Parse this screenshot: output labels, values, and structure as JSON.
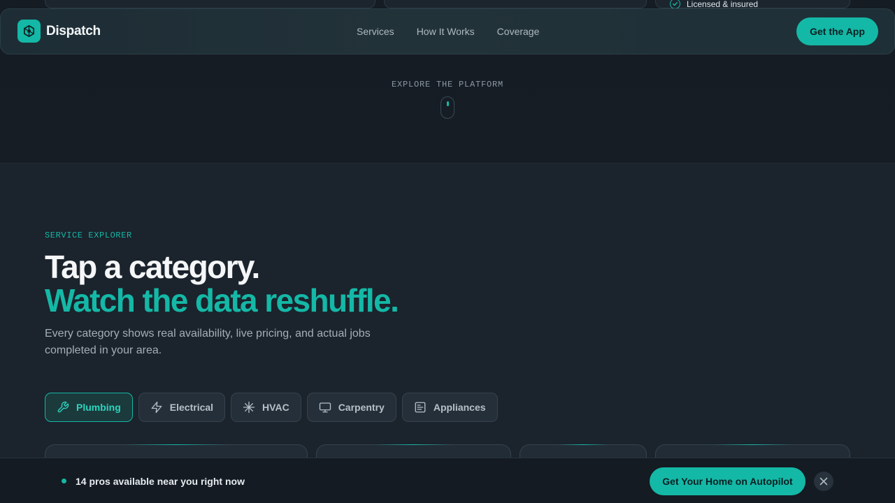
{
  "top_peek": {
    "check_label": "Licensed & insured"
  },
  "nav": {
    "brand": "Dispatch",
    "links": [
      "Services",
      "How It Works",
      "Coverage"
    ],
    "cta": "Get the App"
  },
  "scroll_cue": {
    "label": "EXPLORE THE PLATFORM"
  },
  "explorer": {
    "eyebrow": "SERVICE EXPLORER",
    "headline_1": "Tap a category.",
    "headline_2": "Watch the data reshuffle.",
    "lead": "Every category shows real availability, live pricing, and actual jobs completed in your area.",
    "categories": [
      {
        "label": "Plumbing",
        "icon": "wrench-icon",
        "active": true
      },
      {
        "label": "Electrical",
        "icon": "lightning-icon",
        "active": false
      },
      {
        "label": "HVAC",
        "icon": "snowflake-icon",
        "active": false
      },
      {
        "label": "Carpentry",
        "icon": "monitor-icon",
        "active": false
      },
      {
        "label": "Appliances",
        "icon": "appliance-icon",
        "active": false
      }
    ]
  },
  "bottom_bar": {
    "status": "14 pros available near you right now",
    "cta": "Get Your Home on Autopilot"
  },
  "colors": {
    "accent": "#14b8a6",
    "background": "#1b232c"
  }
}
